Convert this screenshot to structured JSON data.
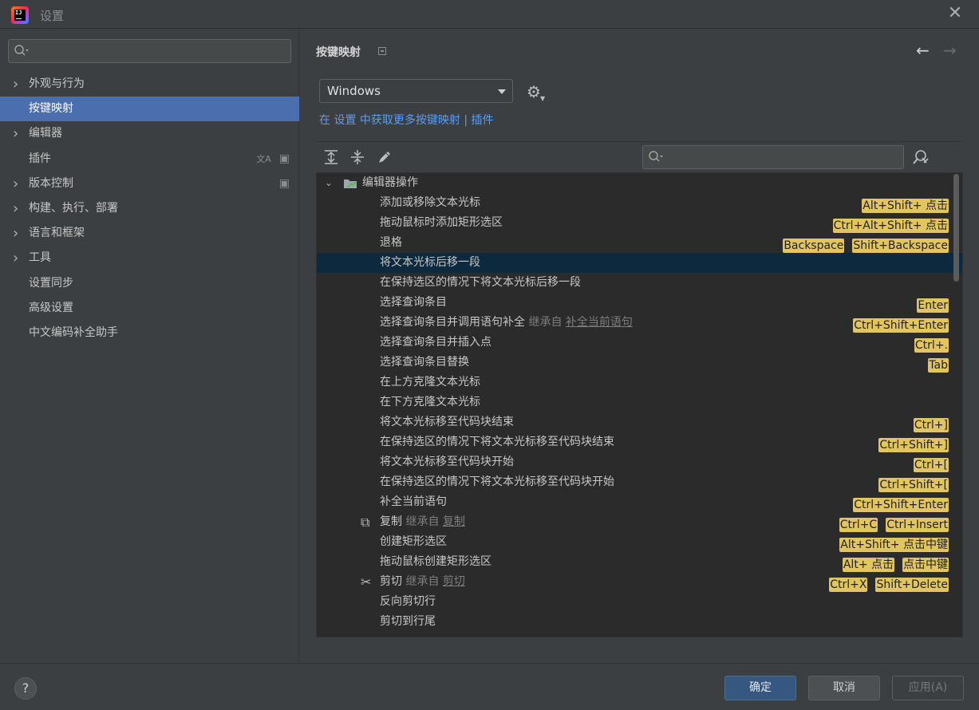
{
  "window": {
    "title": "设置"
  },
  "sidebar": {
    "items": [
      {
        "label": "外观与行为",
        "expandable": true
      },
      {
        "label": "按键映射",
        "expandable": false,
        "selected": true
      },
      {
        "label": "编辑器",
        "expandable": true
      },
      {
        "label": "插件",
        "expandable": false
      },
      {
        "label": "版本控制",
        "expandable": true
      },
      {
        "label": "构建、执行、部署",
        "expandable": true
      },
      {
        "label": "语言和框架",
        "expandable": true
      },
      {
        "label": "工具",
        "expandable": true
      },
      {
        "label": "设置同步",
        "expandable": false
      },
      {
        "label": "高级设置",
        "expandable": false
      },
      {
        "label": "中文编码补全助手",
        "expandable": false
      }
    ]
  },
  "main": {
    "title": "按键映射",
    "keymap": {
      "selected": "Windows"
    },
    "link_prefix": "在 设置 中获取更多按键映射",
    "link_sep": " | ",
    "link_plugins": "插件",
    "tree": {
      "category": "编辑器操作",
      "rows": [
        {
          "label": "添加或移除文本光标",
          "shortcuts": [
            "Alt+Shift+ 点击"
          ]
        },
        {
          "label": "拖动鼠标时添加矩形选区",
          "shortcuts": [
            "Ctrl+Alt+Shift+ 点击"
          ]
        },
        {
          "label": "退格",
          "shortcuts": [
            "Backspace",
            "Shift+Backspace"
          ]
        },
        {
          "label": "将文本光标后移一段",
          "shortcuts": [],
          "selected": true
        },
        {
          "label": "在保持选区的情况下将文本光标后移一段",
          "shortcuts": []
        },
        {
          "label": "选择查询条目",
          "shortcuts": [
            "Enter"
          ]
        },
        {
          "label": "选择查询条目并调用语句补全",
          "inherit_prefix": "继承自",
          "inherit_target": "补全当前语句",
          "shortcuts": [
            "Ctrl+Shift+Enter"
          ]
        },
        {
          "label": "选择查询条目并插入点",
          "shortcuts": [
            "Ctrl+."
          ]
        },
        {
          "label": "选择查询条目替换",
          "shortcuts": [
            "Tab"
          ]
        },
        {
          "label": "在上方克隆文本光标",
          "shortcuts": []
        },
        {
          "label": "在下方克隆文本光标",
          "shortcuts": []
        },
        {
          "label": "将文本光标移至代码块结束",
          "shortcuts": [
            "Ctrl+]"
          ]
        },
        {
          "label": "在保持选区的情况下将文本光标移至代码块结束",
          "shortcuts": [
            "Ctrl+Shift+]"
          ]
        },
        {
          "label": "将文本光标移至代码块开始",
          "shortcuts": [
            "Ctrl+["
          ]
        },
        {
          "label": "在保持选区的情况下将文本光标移至代码块开始",
          "shortcuts": [
            "Ctrl+Shift+["
          ]
        },
        {
          "label": "补全当前语句",
          "shortcuts": [
            "Ctrl+Shift+Enter"
          ]
        },
        {
          "label": "复制",
          "icon": "copy-icon",
          "inherit_prefix": "继承自",
          "inherit_target": "复制",
          "shortcuts": [
            "Ctrl+C",
            "Ctrl+Insert"
          ]
        },
        {
          "label": "创建矩形选区",
          "shortcuts": [
            "Alt+Shift+ 点击中键"
          ]
        },
        {
          "label": "拖动鼠标创建矩形选区",
          "shortcuts": [
            "Alt+ 点击",
            "点击中键"
          ]
        },
        {
          "label": "剪切",
          "icon": "scissors-icon",
          "inherit_prefix": "继承自",
          "inherit_target": "剪切",
          "shortcuts": [
            "Ctrl+X",
            "Shift+Delete"
          ]
        },
        {
          "label": "反向剪切行",
          "shortcuts": []
        },
        {
          "label": "剪切到行尾",
          "shortcuts": []
        }
      ]
    }
  },
  "footer": {
    "help": "?",
    "ok": "确定",
    "cancel": "取消",
    "apply": "应用(A)"
  },
  "colors": {
    "background": "#3c3f41",
    "selection": "#4b6eaf",
    "tree_selection": "#0d293e",
    "shortcut_badge": "#e2c55f",
    "link": "#589df6"
  }
}
